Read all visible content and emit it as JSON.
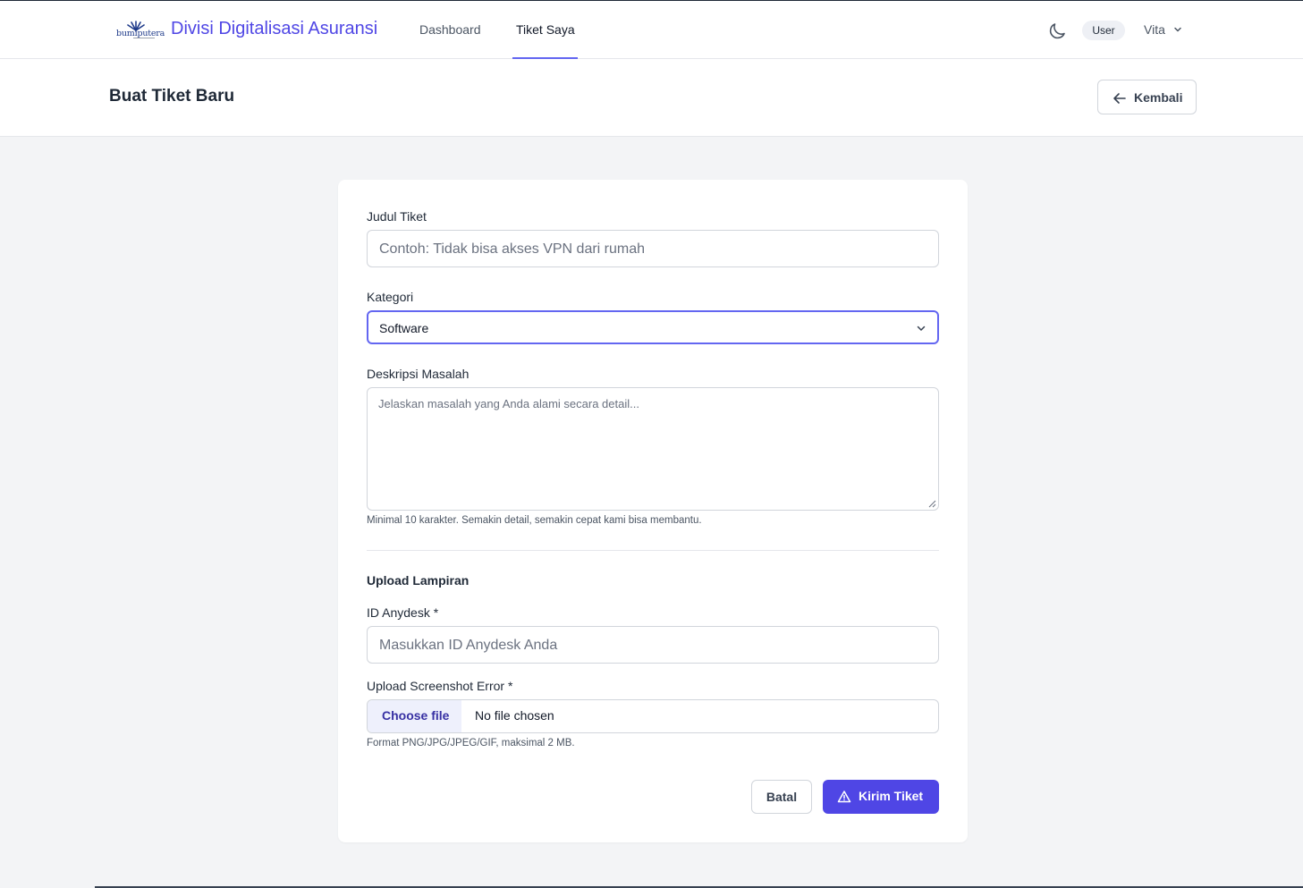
{
  "topbar": {
    "logo_text": "bumiputera",
    "brand": "Divisi Digitalisasi Asuransi",
    "nav": {
      "dashboard": "Dashboard",
      "tiket_saya": "Tiket Saya"
    },
    "role_badge": "User",
    "user_name": "Vita"
  },
  "header": {
    "title": "Buat Tiket Baru",
    "back_label": "Kembali"
  },
  "form": {
    "judul": {
      "label": "Judul Tiket",
      "placeholder": "Contoh: Tidak bisa akses VPN dari rumah"
    },
    "kategori": {
      "label": "Kategori",
      "value": "Software"
    },
    "deskripsi": {
      "label": "Deskripsi Masalah",
      "placeholder": "Jelaskan masalah yang Anda alami secara detail...",
      "hint": "Minimal 10 karakter. Semakin detail, semakin cepat kami bisa membantu."
    },
    "upload_section_title": "Upload Lampiran",
    "anydesk": {
      "label": "ID Anydesk *",
      "placeholder": "Masukkan ID Anydesk Anda"
    },
    "screenshot": {
      "label": "Upload Screenshot Error *",
      "button_label": "Choose file",
      "status": "No file chosen",
      "hint": "Format PNG/JPG/JPEG/GIF, maksimal 2 MB."
    },
    "cancel_label": "Batal",
    "submit_label": "Kirim Tiket"
  },
  "colors": {
    "accent": "#4f46e5",
    "focus_ring": "#6366f1",
    "page_background": "#f3f4f6"
  },
  "icons": {
    "theme": "moon-icon",
    "user_menu": "chevron-down-icon",
    "back": "arrow-left-icon",
    "select": "chevron-down-icon",
    "submit": "warning-triangle-icon"
  }
}
